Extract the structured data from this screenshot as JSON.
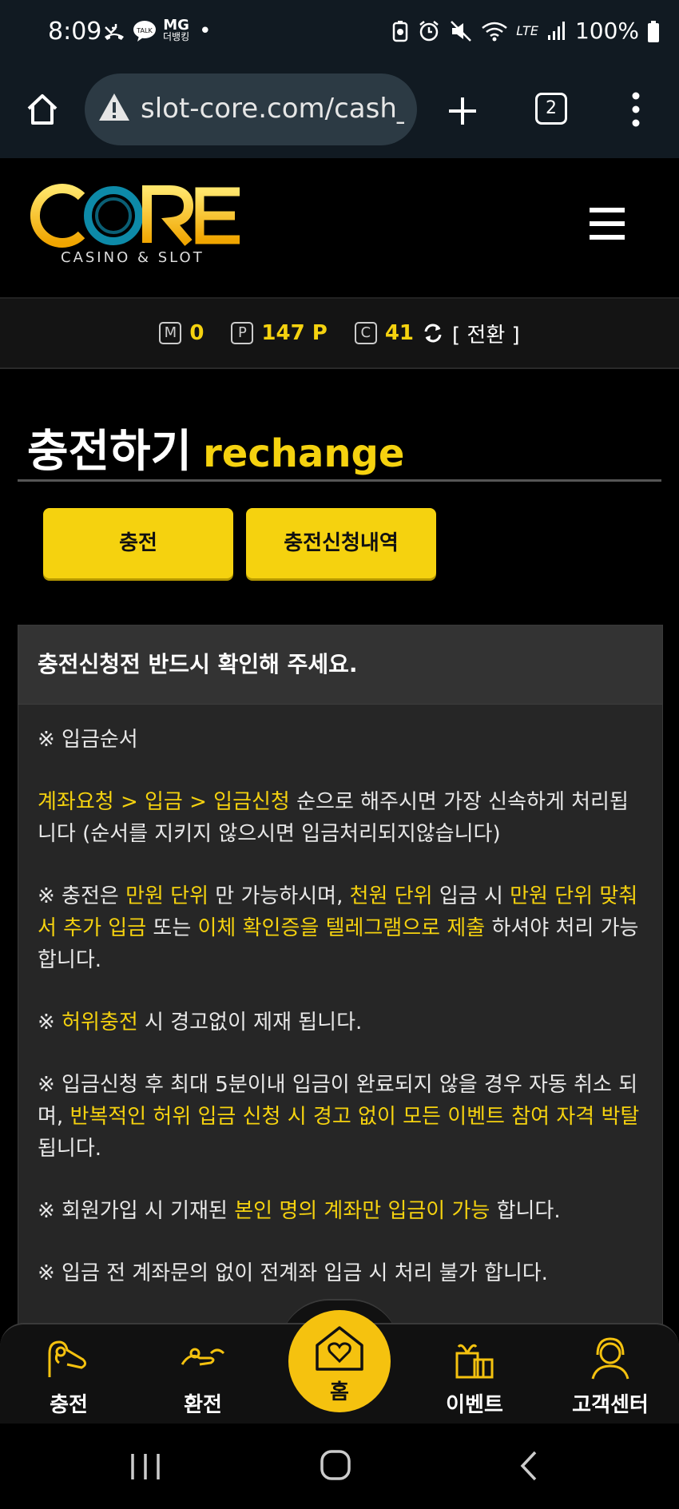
{
  "status": {
    "time": "8:09",
    "battery": "100%",
    "network": "LTE",
    "mg_badge": "MG",
    "mg_sub": "더뱅킹"
  },
  "browser": {
    "url": "slot-core.com/cash_",
    "tab_count": "2"
  },
  "brand": {
    "logo_text": "CORE",
    "logo_sub": "CASINO & SLOT",
    "color": "#f5d20f"
  },
  "points": {
    "m_label": "M",
    "m_value": "0",
    "p_label": "P",
    "p_value": "147 P",
    "c_label": "C",
    "c_value": "41",
    "convert_label": "[ 전환 ]"
  },
  "page": {
    "title_ko": "충전하기",
    "title_en": "rechange"
  },
  "tabs": {
    "charge": "충전",
    "history": "충전신청내역"
  },
  "notice": {
    "heading": "충전신청전 반드시 확인해 주세요.",
    "p1": "※ 입금순서",
    "p2_hl": "계좌요청 > 입금 > 입금신청",
    "p2_rest": " 순으로 해주시면 가장 신속하게 처리됩니다 (순서를 지키지 않으시면 입금처리되지않습니다)",
    "p3_a": "※ 충전은 ",
    "p3_b": "만원 단위",
    "p3_c": " 만 가능하시며, ",
    "p3_d": "천원 단위",
    "p3_e": " 입금 시 ",
    "p3_f": "만원 단위 맞춰서 추가 입금",
    "p3_g": " 또는 ",
    "p3_h": "이체 확인증을 텔레그램으로 제출",
    "p3_i": " 하셔야 처리 가능합니다.",
    "p4_a": "※ ",
    "p4_b": "허위충전",
    "p4_c": " 시 경고없이 제재 됩니다.",
    "p5_a": "※ 입금신청 후 최대 5분이내 입금이 완료되지 않을 경우 자동 취소 되며, ",
    "p5_b": "반복적인 허위 입금 신청 시 경고 없이 모든 이벤트 참여 자격 박탈",
    "p5_c": "됩니다.",
    "p6_a": "※ 회원가입 시 기재된 ",
    "p6_b": "본인 명의 계좌만 입금이 가능",
    "p6_c": " 합니다.",
    "p7": "※ 입금 전 계좌문의 없이 전계좌 입금 시 처리 불가 합니다."
  },
  "bottom_nav": {
    "charge": "충전",
    "exchange": "환전",
    "home": "홈",
    "event": "이벤트",
    "support": "고객센터"
  }
}
